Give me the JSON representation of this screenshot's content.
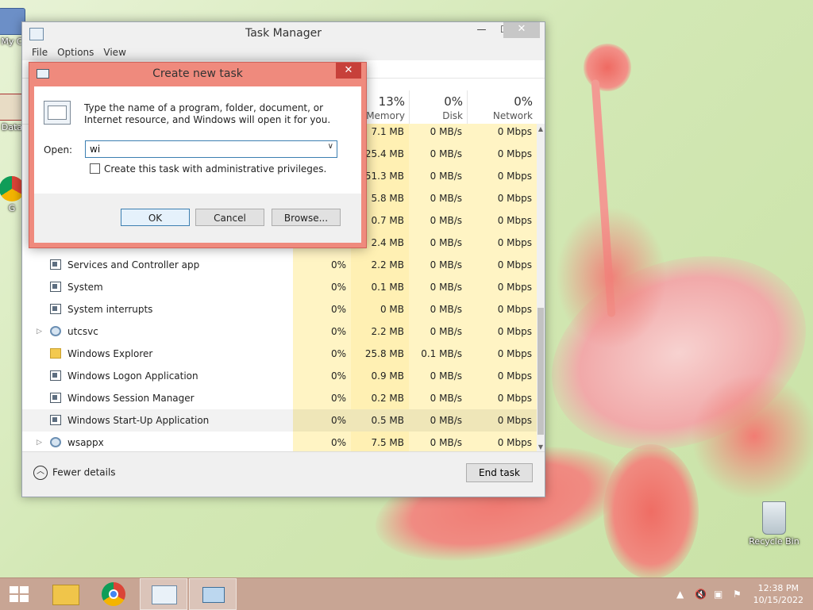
{
  "desktop": {
    "icons": [
      {
        "label": "My C",
        "icon": "computer-icon"
      },
      {
        "label": "Data",
        "icon": "data-icon"
      },
      {
        "label": "G",
        "icon": "chrome-shortcut-icon"
      },
      {
        "label": "Recycle Bin",
        "icon": "recycle-bin-icon"
      }
    ]
  },
  "task_manager": {
    "title": "Task Manager",
    "window_buttons": {
      "minimize": "—",
      "maximize": "☐",
      "close": "✕"
    },
    "menu": [
      "File",
      "Options",
      "View"
    ],
    "columns": [
      {
        "pct": "",
        "label": ""
      },
      {
        "pct": "13%",
        "label": "Memory"
      },
      {
        "pct": "0%",
        "label": "Disk"
      },
      {
        "pct": "0%",
        "label": "Network"
      }
    ],
    "partial_rows": [
      {
        "cpu": "",
        "mem": "7.1 MB",
        "disk": "0 MB/s",
        "net": "0 Mbps"
      },
      {
        "cpu": "",
        "mem": "25.4 MB",
        "disk": "0 MB/s",
        "net": "0 Mbps"
      },
      {
        "cpu": "",
        "mem": "51.3 MB",
        "disk": "0 MB/s",
        "net": "0 Mbps"
      },
      {
        "cpu": "",
        "mem": "5.8 MB",
        "disk": "0 MB/s",
        "net": "0 Mbps"
      },
      {
        "cpu": "",
        "mem": "0.7 MB",
        "disk": "0 MB/s",
        "net": "0 Mbps"
      },
      {
        "cpu": "",
        "mem": "2.4 MB",
        "disk": "0 MB/s",
        "net": "0 Mbps"
      }
    ],
    "processes": [
      {
        "name": "Services and Controller app",
        "icon": "app",
        "expand": false,
        "cpu": "0%",
        "mem": "2.2 MB",
        "disk": "0 MB/s",
        "net": "0 Mbps"
      },
      {
        "name": "System",
        "icon": "app",
        "expand": false,
        "cpu": "0%",
        "mem": "0.1 MB",
        "disk": "0 MB/s",
        "net": "0 Mbps"
      },
      {
        "name": "System interrupts",
        "icon": "app",
        "expand": false,
        "cpu": "0%",
        "mem": "0 MB",
        "disk": "0 MB/s",
        "net": "0 Mbps"
      },
      {
        "name": "utcsvc",
        "icon": "gear",
        "expand": true,
        "cpu": "0%",
        "mem": "2.2 MB",
        "disk": "0 MB/s",
        "net": "0 Mbps"
      },
      {
        "name": "Windows Explorer",
        "icon": "folder",
        "expand": false,
        "cpu": "0%",
        "mem": "25.8 MB",
        "disk": "0.1 MB/s",
        "net": "0 Mbps"
      },
      {
        "name": "Windows Logon Application",
        "icon": "app",
        "expand": false,
        "cpu": "0%",
        "mem": "0.9 MB",
        "disk": "0 MB/s",
        "net": "0 Mbps"
      },
      {
        "name": "Windows Session Manager",
        "icon": "app",
        "expand": false,
        "cpu": "0%",
        "mem": "0.2 MB",
        "disk": "0 MB/s",
        "net": "0 Mbps"
      },
      {
        "name": "Windows Start-Up Application",
        "icon": "app",
        "expand": false,
        "cpu": "0%",
        "mem": "0.5 MB",
        "disk": "0 MB/s",
        "net": "0 Mbps",
        "selected": true
      },
      {
        "name": "wsappx",
        "icon": "gear",
        "expand": true,
        "cpu": "0%",
        "mem": "7.5 MB",
        "disk": "0 MB/s",
        "net": "0 Mbps"
      }
    ],
    "footer": {
      "fewer_details": "Fewer details",
      "end_task": "End task"
    }
  },
  "dialog": {
    "title": "Create new task",
    "close": "✕",
    "description": "Type the name of a program, folder, document, or Internet resource, and Windows will open it for you.",
    "open_label": "Open:",
    "open_value": "wi",
    "admin_checkbox": "Create this task with administrative privileges.",
    "admin_checked": false,
    "ok": "OK",
    "cancel": "Cancel",
    "browse": "Browse..."
  },
  "taskbar": {
    "clock_time": "12:38 PM",
    "clock_date": "10/15/2022"
  }
}
